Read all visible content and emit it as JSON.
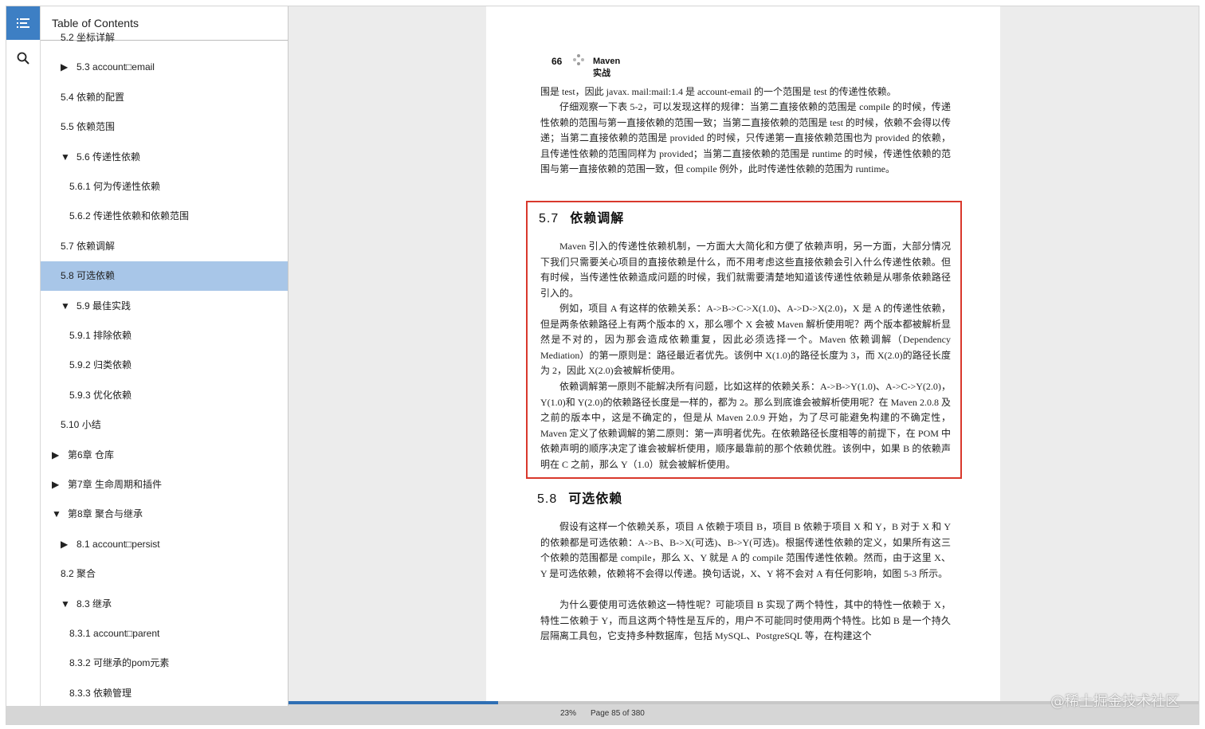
{
  "toc": {
    "title": "Table of Contents",
    "items": [
      {
        "label": "5.2 坐标详解",
        "level": 1,
        "toggle": ""
      },
      {
        "label": "5.3 account□email",
        "level": 1,
        "toggle": "▶"
      },
      {
        "label": "5.4 依赖的配置",
        "level": 1,
        "toggle": ""
      },
      {
        "label": "5.5 依赖范围",
        "level": 1,
        "toggle": ""
      },
      {
        "label": "5.6 传递性依赖",
        "level": 1,
        "toggle": "▼"
      },
      {
        "label": "5.6.1 何为传递性依赖",
        "level": 2,
        "toggle": ""
      },
      {
        "label": "5.6.2 传递性依赖和依赖范围",
        "level": 2,
        "toggle": ""
      },
      {
        "label": "5.7 依赖调解",
        "level": 1,
        "toggle": ""
      },
      {
        "label": "5.8 可选依赖",
        "level": 1,
        "toggle": "",
        "selected": true
      },
      {
        "label": "5.9 最佳实践",
        "level": 1,
        "toggle": "▼"
      },
      {
        "label": "5.9.1 排除依赖",
        "level": 2,
        "toggle": ""
      },
      {
        "label": "5.9.2 归类依赖",
        "level": 2,
        "toggle": ""
      },
      {
        "label": "5.9.3 优化依赖",
        "level": 2,
        "toggle": ""
      },
      {
        "label": "5.10 小结",
        "level": 1,
        "toggle": ""
      },
      {
        "label": "第6章 仓库",
        "level": 0,
        "toggle": "▶"
      },
      {
        "label": "第7章 生命周期和插件",
        "level": 0,
        "toggle": "▶"
      },
      {
        "label": "第8章 聚合与继承",
        "level": 0,
        "toggle": "▼"
      },
      {
        "label": "8.1 account□persist",
        "level": 1,
        "toggle": "▶"
      },
      {
        "label": "8.2 聚合",
        "level": 1,
        "toggle": ""
      },
      {
        "label": "8.3 继承",
        "level": 1,
        "toggle": "▼"
      },
      {
        "label": "8.3.1 account□parent",
        "level": 2,
        "toggle": ""
      },
      {
        "label": "8.3.2 可继承的pom元素",
        "level": 2,
        "toggle": ""
      },
      {
        "label": "8.3.3 依赖管理",
        "level": 2,
        "toggle": ""
      }
    ]
  },
  "page": {
    "number": "66",
    "running_title": "Maven 实战",
    "paragraphs_top": [
      "围是 test，因此 javax. mail:mail:1.4 是 account-email 的一个范围是 test 的传递性依赖。",
      "仔细观察一下表 5-2，可以发现这样的规律：当第二直接依赖的范围是 compile 的时候，传递性依赖的范围与第一直接依赖的范围一致；当第二直接依赖的范围是 test 的时候，依赖不会得以传递；当第二直接依赖的范围是 provided 的时候，只传递第一直接依赖范围也为 provided 的依赖，且传递性依赖的范围同样为 provided；当第二直接依赖的范围是 runtime 的时候，传递性依赖的范围与第一直接依赖的范围一致，但 compile 例外，此时传递性依赖的范围为 runtime。"
    ],
    "section_57": {
      "number": "5.7",
      "title": "依赖调解",
      "paragraphs": [
        "Maven 引入的传递性依赖机制，一方面大大简化和方便了依赖声明，另一方面，大部分情况下我们只需要关心项目的直接依赖是什么，而不用考虑这些直接依赖会引入什么传递性依赖。但有时候，当传递性依赖造成问题的时候，我们就需要清楚地知道该传递性依赖是从哪条依赖路径引入的。",
        "例如，项目 A 有这样的依赖关系：A->B->C->X(1.0)、A->D->X(2.0)，X 是 A 的传递性依赖，但是两条依赖路径上有两个版本的 X，那么哪个 X 会被 Maven 解析使用呢？两个版本都被解析显然是不对的，因为那会造成依赖重复，因此必须选择一个。Maven 依赖调解（Dependency Mediation）的第一原则是：路径最近者优先。该例中 X(1.0)的路径长度为 3，而 X(2.0)的路径长度为 2，因此 X(2.0)会被解析使用。",
        "依赖调解第一原则不能解决所有问题，比如这样的依赖关系：A->B->Y(1.0)、A->C->Y(2.0)，Y(1.0)和 Y(2.0)的依赖路径长度是一样的，都为 2。那么到底谁会被解析使用呢？在 Maven 2.0.8 及之前的版本中，这是不确定的，但是从 Maven 2.0.9 开始，为了尽可能避免构建的不确定性，Maven 定义了依赖调解的第二原则：第一声明者优先。在依赖路径长度相等的前提下，在 POM 中依赖声明的顺序决定了谁会被解析使用，顺序最靠前的那个依赖优胜。该例中，如果 B 的依赖声明在 C 之前，那么 Y（1.0）就会被解析使用。"
      ]
    },
    "section_58": {
      "number": "5.8",
      "title": "可选依赖",
      "paragraphs": [
        "假设有这样一个依赖关系，项目 A 依赖于项目 B，项目 B 依赖于项目 X 和 Y，B 对于 X 和 Y 的依赖都是可选依赖：A->B、B->X(可选)、B->Y(可选)。根据传递性依赖的定义，如果所有这三个依赖的范围都是 compile，那么 X、Y 就是 A 的 compile 范围传递性依赖。然而，由于这里 X、Y 是可选依赖，依赖将不会得以传递。换句话说，X、Y 将不会对 A 有任何影响，如图 5-3 所示。",
        "为什么要使用可选依赖这一特性呢？可能项目 B 实现了两个特性，其中的特性一依赖于 X，特性二依赖于 Y，而且这两个特性是互斥的，用户不可能同时使用两个特性。比如 B 是一个持久层隔离工具包，它支持多种数据库，包括 MySQL、PostgreSQL 等，在构建这个"
      ]
    }
  },
  "status": {
    "percent_label": "23%",
    "page_label": "Page 85 of 380",
    "progress": 0.23
  },
  "watermark": "@稀土掘金技术社区",
  "colors": {
    "accent": "#3d7fc4",
    "selection": "#a8c6e8",
    "highlight_box": "#d9382c"
  }
}
